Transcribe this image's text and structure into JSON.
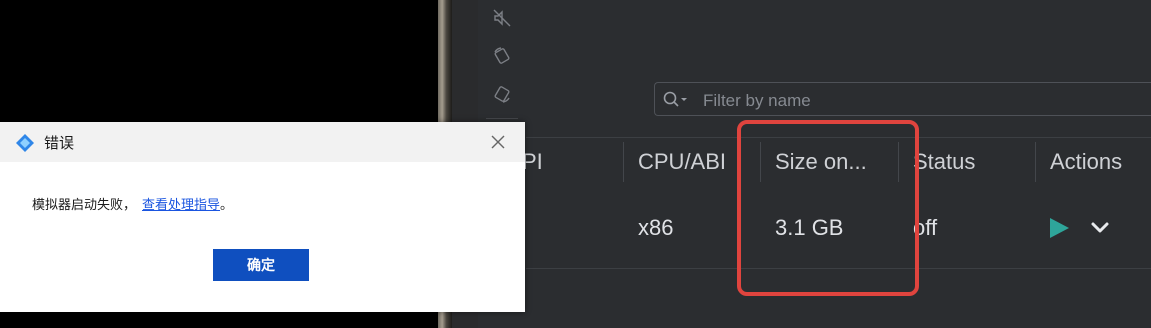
{
  "device_manager": {
    "search": {
      "placeholder": "Filter by name",
      "icon": "search-icon"
    },
    "columns": [
      "PI",
      "CPU/ABI",
      "Size on...",
      "Status",
      "Actions"
    ],
    "rows": [
      {
        "api": "",
        "cpu_abi": "x86",
        "size_on_disk": "3.1 GB",
        "status": "off"
      }
    ]
  },
  "dialog": {
    "title": "错误",
    "message": "模拟器启动失败，",
    "link": "查看处理指导",
    "message_end": "。",
    "ok_button": "确定"
  },
  "colors": {
    "highlight": "#e0443e",
    "play": "#2ea59a",
    "dialog_button": "#0f4fbf",
    "link": "#1a55e0"
  }
}
